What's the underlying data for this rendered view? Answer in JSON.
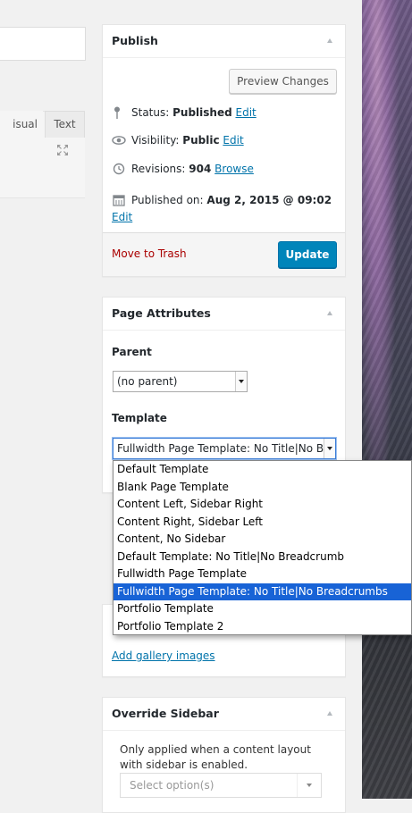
{
  "editor": {
    "tab_visual": "isual",
    "tab_text": "Text"
  },
  "publish": {
    "title": "Publish",
    "preview_button": "Preview Changes",
    "status_label": "Status:",
    "status_value": "Published",
    "status_edit": "Edit",
    "visibility_label": "Visibility:",
    "visibility_value": "Public",
    "visibility_edit": "Edit",
    "revisions_label": "Revisions:",
    "revisions_value": "904",
    "revisions_browse": "Browse",
    "published_label": "Published on:",
    "published_value": "Aug 2, 2015 @ 09:02",
    "published_edit": "Edit",
    "trash_link": "Move to Trash",
    "update_button": "Update"
  },
  "page_attributes": {
    "title": "Page Attributes",
    "parent_label": "Parent",
    "parent_value": "(no parent)",
    "template_label": "Template",
    "template_value": "Fullwidth Page Template: No Title|No Breadcrumbs",
    "template_options": [
      "Default Template",
      "Blank Page Template",
      "Content Left, Sidebar Right",
      "Content Right, Sidebar Left",
      "Content, No Sidebar",
      "Default Template: No Title|No Breadcrumb",
      "Fullwidth Page Template",
      "Fullwidth Page Template: No Title|No Breadcrumbs",
      "Portfolio Template",
      "Portfolio Template 2"
    ],
    "selected_index": 7
  },
  "gallery": {
    "add_link": "Add gallery images"
  },
  "override_sidebar": {
    "title": "Override Sidebar",
    "note": "Only applied when a content layout with sidebar is enabled.",
    "select_placeholder": "Select option(s)"
  },
  "colors": {
    "primary_button": "#0085ba",
    "link": "#0073aa",
    "trash": "#aa0000",
    "selected_option": "#1863d6"
  }
}
